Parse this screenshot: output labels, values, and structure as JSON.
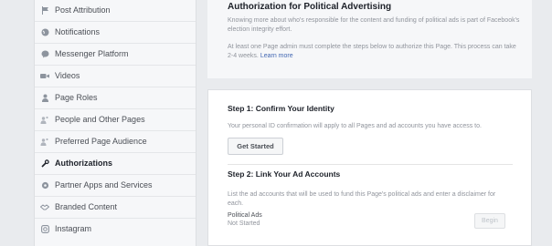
{
  "sidebar": {
    "items": [
      {
        "label": "Post Attribution",
        "icon": "flag-icon"
      },
      {
        "label": "Notifications",
        "icon": "globe-icon"
      },
      {
        "label": "Messenger Platform",
        "icon": "messenger-icon"
      },
      {
        "label": "Videos",
        "icon": "video-camera-icon"
      },
      {
        "label": "Page Roles",
        "icon": "person-icon"
      },
      {
        "label": "People and Other Pages",
        "icon": "people-icon"
      },
      {
        "label": "Preferred Page Audience",
        "icon": "audience-icon"
      },
      {
        "label": "Authorizations",
        "icon": "wrench-icon",
        "active": true
      },
      {
        "label": "Partner Apps and Services",
        "icon": "gear-icon"
      },
      {
        "label": "Branded Content",
        "icon": "handshake-icon"
      },
      {
        "label": "Instagram",
        "icon": "instagram-icon"
      }
    ]
  },
  "header": {
    "title": "Authorization for Political Advertising",
    "desc1": "Knowing more about who's responsible for the content and funding of political ads is part of Facebook's election integrity effort.",
    "desc2": "At least one Page admin must complete the steps below to authorize this Page. This process can take 2-4 weeks.",
    "learn_more": "Learn more"
  },
  "step1": {
    "title": "Step 1: Confirm Your Identity",
    "desc": "Your personal ID confirmation will apply to all Pages and ad accounts you have access to.",
    "button": "Get Started"
  },
  "step2": {
    "title": "Step 2: Link Your Ad Accounts",
    "desc": "List the ad accounts that will be used to fund this Page's political ads and enter a disclaimer for each.",
    "item_label": "Political Ads",
    "item_status": "Not Started",
    "button": "Begin"
  }
}
